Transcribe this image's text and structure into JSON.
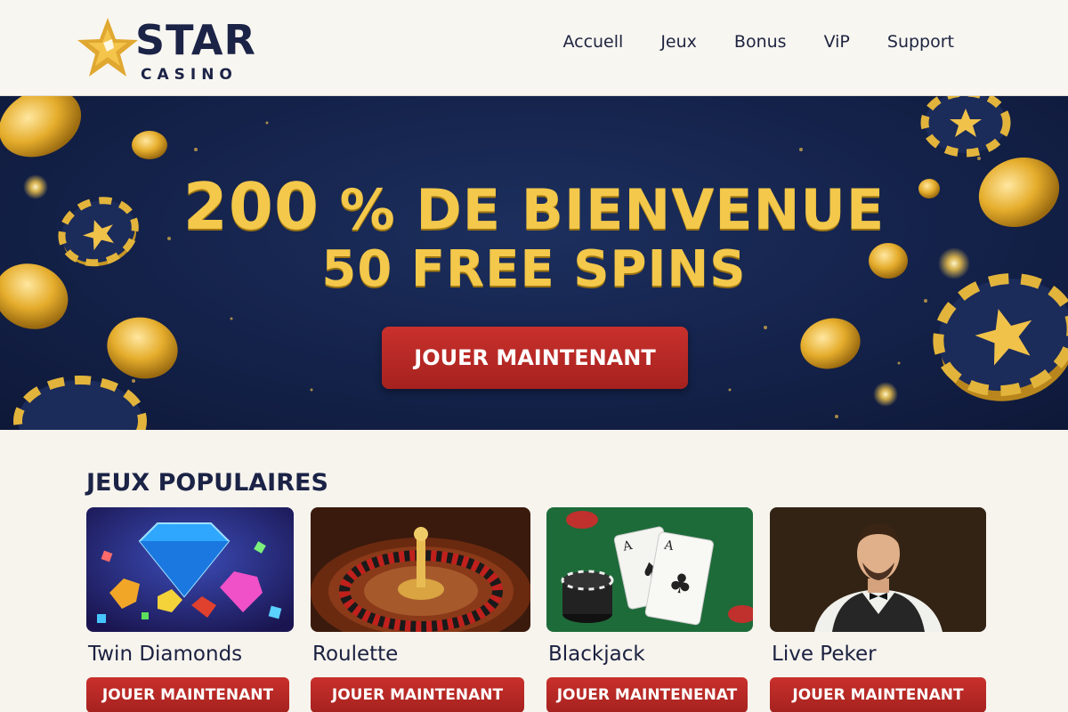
{
  "header": {
    "logo_word": "STAR",
    "logo_sub": "CASINO",
    "nav": [
      "Accuell",
      "Jeux",
      "Bonus",
      "ViP",
      "Support"
    ]
  },
  "hero": {
    "headline_number": "200",
    "headline_rest": "% DE BIENVENUE",
    "subheadline": "50 FREE SPINS",
    "cta": "JOUER MAINTENANT"
  },
  "popular": {
    "title": "JEUX POPULAIRES",
    "games": [
      {
        "name": "Twin Diamonds",
        "button": "JOUER MAINTENANT",
        "image": "diamonds-icon"
      },
      {
        "name": "Roulette",
        "button": "JOUER MAINTENANT",
        "image": "roulette-wheel-icon"
      },
      {
        "name": "Blackjack",
        "button": "JOUER MAINTENENAT",
        "image": "playing-cards-icon"
      },
      {
        "name": "Live Peker",
        "button": "JOUER MAINTENANT",
        "image": "dealer-icon"
      }
    ]
  },
  "colors": {
    "brand_navy": "#1b2346",
    "gold": "#f3c84b",
    "cta_red": "#b8272a",
    "hero_bg": "#14224a"
  }
}
